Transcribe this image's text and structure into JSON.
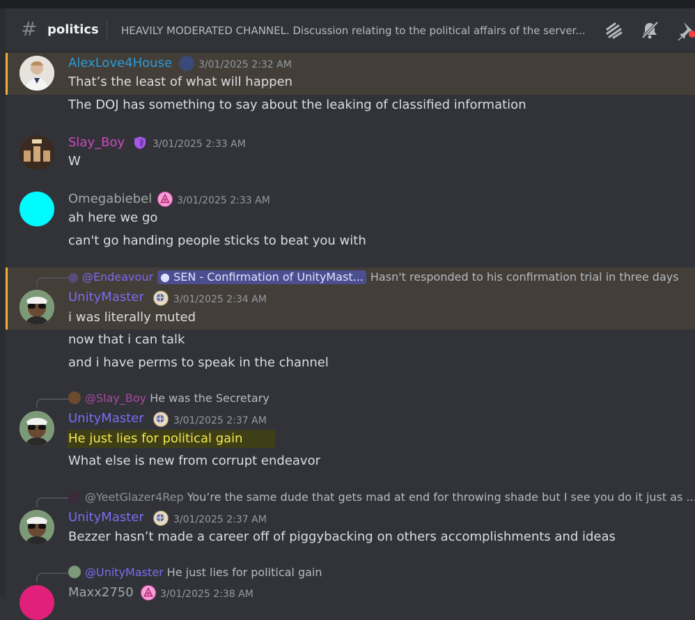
{
  "channel": {
    "name": "politics",
    "topic": "HEAVILY MODERATED CHANNEL. Discussion relating to the political affairs of the server..."
  },
  "colors": {
    "background": "#323339",
    "highlight_row": "#433e38",
    "highlight_bar": "#f0b232",
    "blue_name": "#2a9bd9",
    "pink_name": "#d248c0",
    "gray_name": "#a1a8a8",
    "purple_name": "#7c6cf0",
    "yellow_highlight_text": "#f6e94e"
  },
  "header_icons": [
    "threads-icon",
    "bell-muted-icon",
    "pin-icon"
  ],
  "messages": [
    {
      "author": "AlexLove4House",
      "timestamp": "3/01/2025 2:32 AM",
      "lines": [
        "That’s the least of what will happen",
        "The DOJ has something to say about the leaking of classified information"
      ]
    },
    {
      "author": "Slay_Boy",
      "timestamp": "3/01/2025 2:33 AM",
      "lines": [
        "W"
      ]
    },
    {
      "author": "Omegabiebel",
      "timestamp": "3/01/2025 2:33 AM",
      "lines": [
        "ah here we go",
        "can't go handing people sticks to beat you with"
      ]
    },
    {
      "reply_to": "@Endeavour",
      "reply_thread": "SEN - Confirmation of UnityMast...",
      "reply_text": "Hasn't responded to his confirmation trial in three days",
      "author": "UnityMaster",
      "timestamp": "3/01/2025 2:34 AM",
      "lines": [
        "i was literally muted",
        "now that i can talk",
        "and i have perms to speak in the channel"
      ]
    },
    {
      "reply_to": "@Slay_Boy",
      "reply_text": "He was the Secretary",
      "author": "UnityMaster",
      "timestamp": "3/01/2025 2:37 AM",
      "lines": [
        "He just lies for political gain",
        "What else is new from corrupt endeavor"
      ]
    },
    {
      "reply_to": "@YeetGlazer4Rep",
      "reply_text": "You’re the same dude that gets mad at end for throwing shade but I see you do it just as ...",
      "author": "UnityMaster",
      "timestamp": "3/01/2025 2:37 AM",
      "lines": [
        "Bezzer hasn’t made a career off of piggybacking on others accomplishments and ideas"
      ]
    },
    {
      "reply_to": "@UnityMaster",
      "reply_text": "He just lies for political gain",
      "author": "Maxx2750",
      "timestamp": "3/01/2025 2:38 AM",
      "lines": []
    }
  ]
}
